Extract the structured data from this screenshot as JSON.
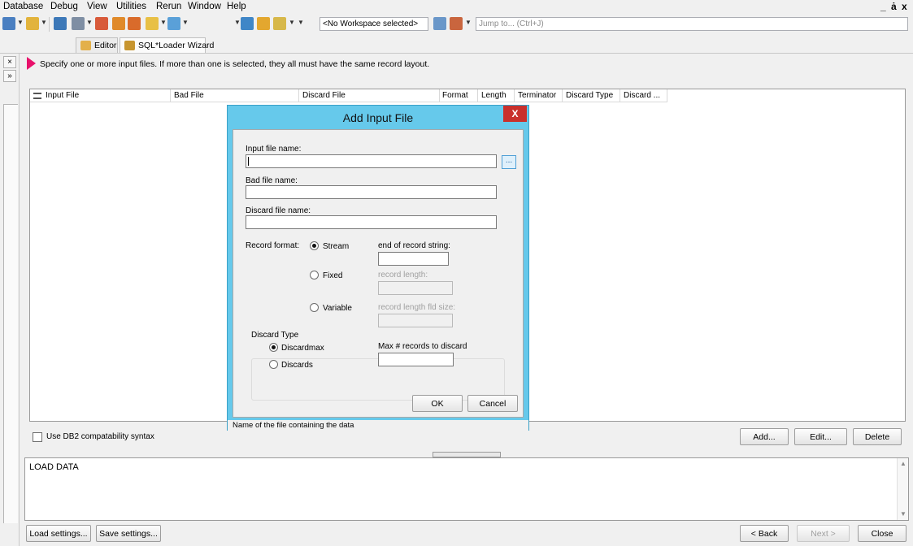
{
  "menu": {
    "items": [
      "Database",
      "Debug",
      "View",
      "Utilities",
      "Rerun",
      "Window",
      "Help"
    ],
    "window_controls": [
      "_",
      "ȧ",
      "x"
    ]
  },
  "toolbar": {
    "workspace_value": "<No Workspace selected>",
    "jump_placeholder": "Jump to... (Ctrl+J)"
  },
  "tabs": [
    {
      "label": "Editor",
      "icon": "editor-icon"
    },
    {
      "label": "SQL*Loader Wizard",
      "icon": "sql-loader-icon"
    }
  ],
  "instruction": "Specify one or more input files. If more than one is selected, they all must have the same record layout.",
  "grid": {
    "columns": [
      "Input File",
      "Bad File",
      "Discard File",
      "Format",
      "Length",
      "Terminator",
      "Discard Type",
      "Discard ..."
    ],
    "rows": []
  },
  "options": {
    "db2_label": "Use DB2 compatability syntax",
    "db2_checked": false
  },
  "grid_buttons": {
    "add": "Add...",
    "edit": "Edit...",
    "delete": "Delete"
  },
  "sql_preview": "LOAD DATA",
  "footer": {
    "load_settings": "Load settings...",
    "save_settings": "Save settings...",
    "back": "< Back",
    "next": "Next >",
    "close": "Close"
  },
  "dialog": {
    "title": "Add Input File",
    "close": "X",
    "input_file_label": "Input file name:",
    "input_file_value": "",
    "browse": "...",
    "bad_file_label": "Bad file name:",
    "bad_file_value": "",
    "discard_file_label": "Discard file name:",
    "discard_file_value": "",
    "record_format_label": "Record format:",
    "formats": [
      {
        "label": "Stream",
        "selected": true
      },
      {
        "label": "Fixed",
        "selected": false
      },
      {
        "label": "Variable",
        "selected": false
      }
    ],
    "eor_label": "end of record string:",
    "record_length_label": "record length:",
    "record_length_fld_label": "record length fld size:",
    "discard_type_label": "Discard Type",
    "discard_types": [
      {
        "label": "Discardmax",
        "selected": true
      },
      {
        "label": "Discards",
        "selected": false
      }
    ],
    "max_discard_label": "Max # records to discard",
    "ok": "OK",
    "cancel": "Cancel",
    "status": "Name of the file containing the data"
  },
  "colors": {
    "dialog_frame": "#66c9eb",
    "close_button": "#c9302c",
    "instruction_arrow": "#e8116b"
  }
}
